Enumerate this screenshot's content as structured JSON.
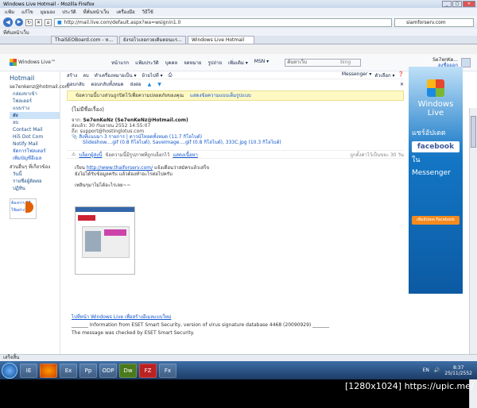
{
  "window": {
    "title": "Windows Live Hotmail - Mozilla Firefox"
  },
  "menubar": {
    "items": [
      "แฟ้ม",
      "แก้ไข",
      "มุมมอง",
      "ประวัติ",
      "ที่คั่นหน้าเว็บ",
      "เครื่องมือ",
      "วิธีใช้"
    ]
  },
  "navbar": {
    "url": "http://mail.live.com/default.aspx?wa=wsignin1.0",
    "search": "siamforserv.com"
  },
  "bookmarks": {
    "label": "ที่คั่นหน้าเว็บ"
  },
  "tabs": [
    "ThaiSEOBoard.com - ห...",
    "ยังรอไวเลอกวยเดิมตอนแร...",
    "Windows Live Hotmail"
  ],
  "hotmail": {
    "brand": "Windows Live™",
    "topnav": [
      "หน้าแรก",
      "แฟ้มประวัติ",
      "บุคคล",
      "จดหมาย",
      "รูปถ่าย",
      "เพิ่มเติม ▾",
      "MSN ▾"
    ],
    "search_placeholder": "ค้นหาเว็บ",
    "bing": "bing",
    "user_name": "Se7enKe...",
    "user_signout": "ลงชื่อออก"
  },
  "sidebar": {
    "title": "Hotmail",
    "account": "se7enkenz@hotmail.com",
    "items": [
      "กล่องขาเข้า",
      "โฟลเดอร์",
      "แบบร่าง",
      "ส่ง",
      "ลบ",
      "Contact Mail",
      "Hi5 Dot Com",
      "Notify Mail",
      "จัดการโฟลเดอร์",
      "เพิ่มบัญชีอีเมล",
      "ส่วนอื่นๆ ที่เกี่ยวข้อง",
      "วันนี้",
      "รายชื่อผู้ติดต่อ",
      "ปฏิทิน"
    ],
    "promo": "ต้องการ วิธีใช้อย่าง?"
  },
  "toolbar": {
    "items": [
      "สร้าง",
      "ลบ",
      "ทำเครื่องหมายเป็น ▾",
      "ย้ายไปที่ ▾"
    ],
    "right": [
      "Messenger ▾",
      "ตัวเลือก ▾"
    ]
  },
  "toolbar2": {
    "items": [
      "ตอบกลับ",
      "ตอบกลับทั้งหมด",
      "ส่งต่อ"
    ]
  },
  "notice": {
    "text": "ข้อความนี้บางส่วนถูกปิดไว้เพื่อความปลอดภัยของคุณ",
    "link": "แสดงข้อความแบบเต็มรูปแบบ"
  },
  "message": {
    "subject": "(ไม่มีชื่อเรื่อง)",
    "from_label": "จาก:",
    "from": "Se7enKeNz (Se7enKeNz@Hotmail.com)",
    "sent_label": "ส่งแล้ว:",
    "sent": "30 กันยายน 2552 14:55:07",
    "to_label": "ถึง:",
    "to": "support@hostinglotus.com",
    "attach_summary": "สิ่งที่แนบมา 3 รายการ | ดาวน์โหลดทั้งหมด (11.7 กิโลไบต์)",
    "attachments": "Slideshow....gif (0.8 กิโลไบต์), SaveImage....gif (0.8 กิโลไบต์), 333C.jpg (10.3 กิโลไบต์)",
    "safety_link": "บล็อกผู้ส่งนี้",
    "safety_text": "ข้อความนี้มีรูปภาพที่ถูกบล็อกไว้",
    "safety_show": "แสดงเนื้อหา",
    "spam_note": "ถูกตั้งค่าไว้เป็นขยะ 30 วัน",
    "line1_pre": "เรียน",
    "line1_link": "http://www.thaiforserv.com/",
    "line1_post": "แจ้งเตือนว่าสมัครแล้วเสร็จ",
    "line2": "ยังไม่ได้รับข้อมูลครับ แล้วต้องทำอะไรต่อไปครับ",
    "line3": "เพลินๆมาไม่ได้อะไรเลย~~",
    "footer_link": "ไปที่หน้า Windows Live เพื่อสร้างอีเมลแบบใหม่",
    "footer_line1": "_______ Information from ESET Smart Security, version of virus signature database 4468 (20090929) _______",
    "footer_line2": "The message was checked by ESET Smart Security."
  },
  "ad": {
    "brand1": "Windows",
    "brand2": "Live",
    "line1": "แชร์อัปเดต",
    "facebook": "facebook",
    "line2": "ใน",
    "line3": "Messenger",
    "button": "เพิ่มอัปเดต Facebook"
  },
  "status": {
    "text": "เสร็จสิ้น"
  },
  "taskbar": {
    "lang": "EN",
    "time": "8:37",
    "date": "25/11/2552",
    "apps": [
      "IE",
      "Ex",
      "Pp",
      "ODP",
      "Dw",
      "FZ",
      "Fx"
    ]
  },
  "watermark": "[1280x1024] https://upic.me/"
}
